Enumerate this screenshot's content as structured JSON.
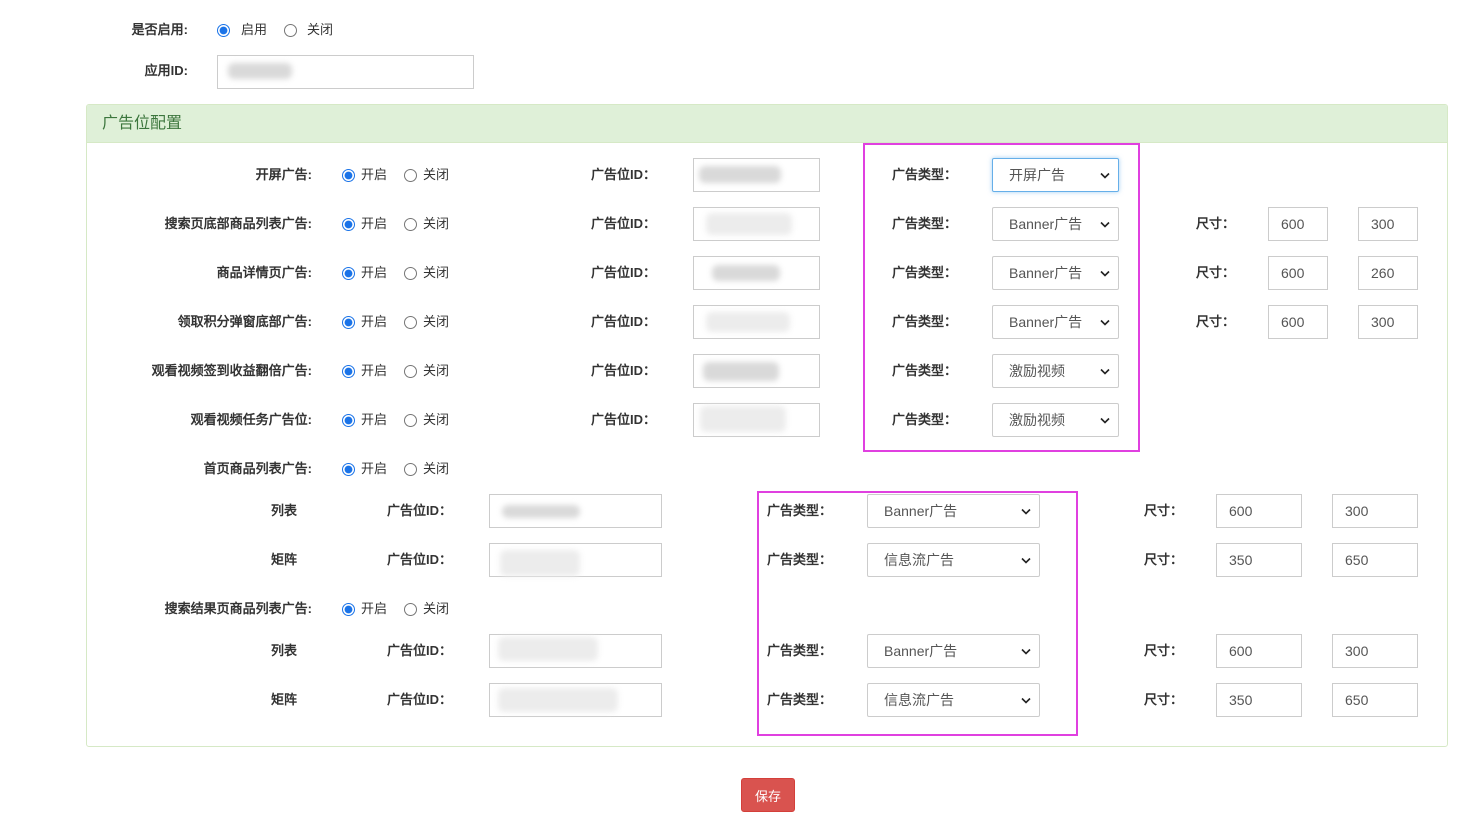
{
  "enable": {
    "label": "是否启用:",
    "on": "启用",
    "off": "关闭",
    "enabled": true
  },
  "app_id": {
    "label": "应用ID:"
  },
  "panel": {
    "title": "广告位配置"
  },
  "common": {
    "on": "开启",
    "off": "关闭",
    "ad_id_label": "广告位ID：",
    "ad_type_label": "广告类型：",
    "size_label": "尺寸："
  },
  "ad_slots": [
    {
      "label": "开屏广告:",
      "enabled": true,
      "ad_type": "开屏广告"
    },
    {
      "label": "搜索页底部商品列表广告:",
      "enabled": true,
      "ad_type": "Banner广告",
      "width": "600",
      "height": "300"
    },
    {
      "label": "商品详情页广告:",
      "enabled": true,
      "ad_type": "Banner广告",
      "width": "600",
      "height": "260"
    },
    {
      "label": "领取积分弹窗底部广告:",
      "enabled": true,
      "ad_type": "Banner广告",
      "width": "600",
      "height": "300"
    },
    {
      "label": "观看视频签到收益翻倍广告:",
      "enabled": true,
      "ad_type": "激励视频"
    },
    {
      "label": "观看视频任务广告位:",
      "enabled": true,
      "ad_type": "激励视频"
    }
  ],
  "list_slots": [
    {
      "label": "首页商品列表广告:",
      "enabled": true,
      "items": [
        {
          "label": "列表",
          "ad_type": "Banner广告",
          "width": "600",
          "height": "300"
        },
        {
          "label": "矩阵",
          "ad_type": "信息流广告",
          "width": "350",
          "height": "650"
        }
      ]
    },
    {
      "label": "搜索结果页商品列表广告:",
      "enabled": true,
      "items": [
        {
          "label": "列表",
          "ad_type": "Banner广告",
          "width": "600",
          "height": "300"
        },
        {
          "label": "矩阵",
          "ad_type": "信息流广告",
          "width": "350",
          "height": "650"
        }
      ]
    }
  ],
  "save_label": "保存",
  "colors": {
    "radio_accent": "#1a73e8",
    "panel_header_bg": "#dff0d8",
    "panel_title": "#3c763d",
    "highlight_box": "#e040e0",
    "save_button": "#d9534f"
  }
}
